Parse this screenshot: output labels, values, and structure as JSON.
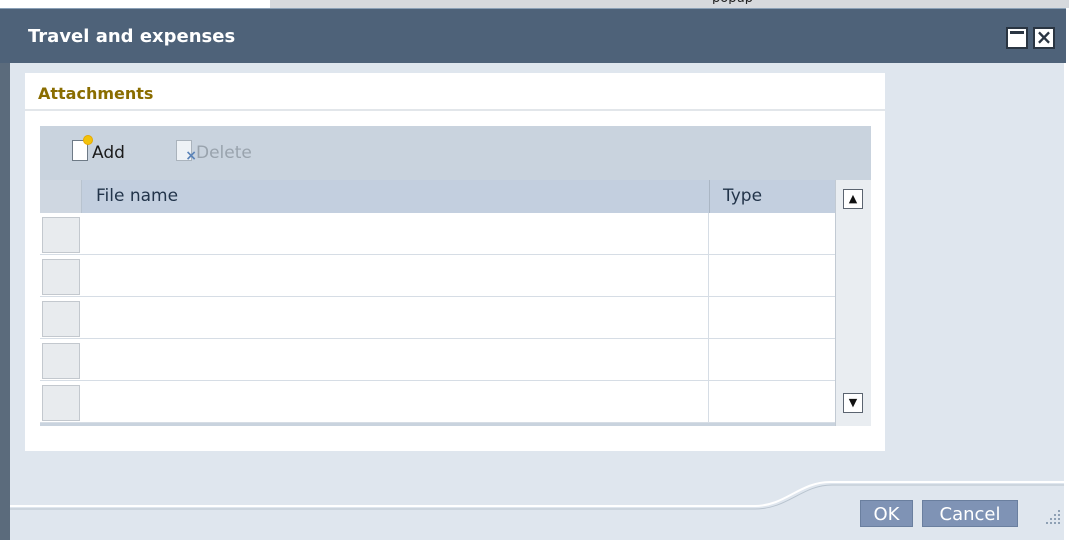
{
  "page_hint": "popup",
  "dialog": {
    "title": "Travel and expenses",
    "maximize_icon": "maximize-icon",
    "close_icon": "close-icon"
  },
  "attachments": {
    "section_title": "Attachments",
    "toolbar": {
      "add_label": "Add",
      "add_icon": "new-document-icon",
      "delete_label": "Delete",
      "delete_icon": "delete-document-icon",
      "delete_enabled": false
    },
    "table": {
      "columns": [
        "File name",
        "Type"
      ],
      "rows": [
        {
          "file_name": "",
          "type": ""
        },
        {
          "file_name": "",
          "type": ""
        },
        {
          "file_name": "",
          "type": ""
        },
        {
          "file_name": "",
          "type": ""
        },
        {
          "file_name": "",
          "type": ""
        }
      ]
    }
  },
  "footer": {
    "ok_label": "OK",
    "cancel_label": "Cancel"
  },
  "colors": {
    "titlebar": "#4e6279",
    "section_title": "#8a6d00",
    "button": "#7f93b5"
  }
}
